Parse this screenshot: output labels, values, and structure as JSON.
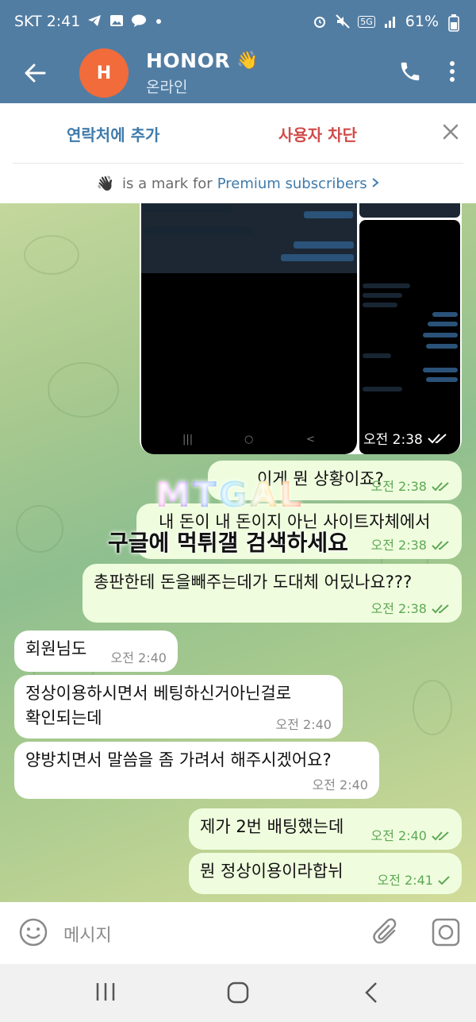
{
  "status_bar": {
    "carrier_time": "SKT 2:41",
    "battery": "61%",
    "network": "5G"
  },
  "header": {
    "avatar_letter": "H",
    "name": "HONOR",
    "emoji": "👋",
    "status": "온라인"
  },
  "action_bar": {
    "add_contact": "연락처에 추가",
    "block_user": "사용자 차단"
  },
  "premium_banner": {
    "emoji": "👋",
    "text": "is a mark for",
    "link": "Premium subscribers"
  },
  "album": {
    "time": "오전 2:38"
  },
  "messages": [
    {
      "text": "이게 뭔 상황이죠?",
      "time": "오전 2:38",
      "direction": "out"
    },
    {
      "text": "내 돈이 내 돈이지 아닌 사이트자체에서",
      "time": "오전 2:38",
      "direction": "out"
    },
    {
      "text": "총판한테 돈을빼주는데가 도대체 어딨나요???",
      "time": "오전 2:38",
      "direction": "out"
    },
    {
      "text": "회원님도",
      "time": "오전 2:40",
      "direction": "in"
    },
    {
      "text_line1": "정상이용하시면서 베팅하신거아닌걸로",
      "text_line2": "확인되는데",
      "time": "오전 2:40",
      "direction": "in"
    },
    {
      "text": "양방치면서 말씀을 좀 가려서 해주시겠어요?",
      "time": "오전 2:40",
      "direction": "in"
    },
    {
      "text": "제가 2번 배팅했는데",
      "time": "오전 2:40",
      "direction": "out"
    },
    {
      "text": "뭔 정상이용이라합뉘",
      "time": "오전 2:41",
      "direction": "out"
    }
  ],
  "watermark": {
    "logo": "MTGAL",
    "caption": "구글에 먹튀갤 검색하세요"
  },
  "input": {
    "placeholder": "메시지"
  },
  "colors": {
    "header_bg": "#527da3",
    "outgoing_bubble": "#effdde",
    "incoming_bubble": "#ffffff",
    "link": "#3f7bab",
    "danger": "#d24a4a",
    "avatar": "#f26b3a"
  }
}
